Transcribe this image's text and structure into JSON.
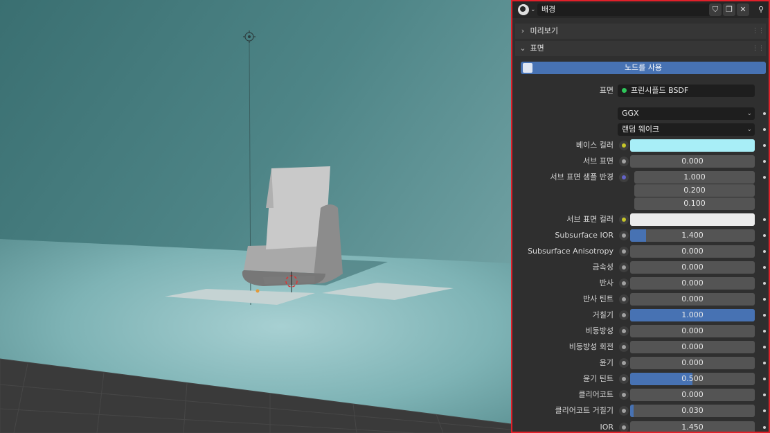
{
  "panel": {
    "world_name": "배경",
    "header_buttons": [
      "shield-icon",
      "copy-icon",
      "close-icon"
    ],
    "sections": {
      "preview": "미리보기",
      "surface": "표면"
    },
    "use_nodes_label": "노드를 사용",
    "surface_label": "표면",
    "surface_value": "프린시플드 BSDF",
    "distribution": "GGX",
    "subsurface_method": "랜덤 웨이크",
    "props": [
      {
        "label": "베이스 컬러",
        "type": "color",
        "color": "#a8eef7",
        "socket": "yellow"
      },
      {
        "label": "서브 표면",
        "value": "0.000",
        "fill": 0
      },
      {
        "label": "서브 표면 샘플 반경",
        "value": "1.000",
        "socket": "purple",
        "vector": [
          "1.000",
          "0.200",
          "0.100"
        ]
      },
      {
        "label": "서브 표면 컬러",
        "type": "color",
        "color": "#ececec",
        "socket": "yellow"
      },
      {
        "label": "Subsurface IOR",
        "value": "1.400",
        "fill": 0.13
      },
      {
        "label": "Subsurface Anisotropy",
        "value": "0.000",
        "fill": 0
      },
      {
        "label": "금속성",
        "value": "0.000",
        "fill": 0
      },
      {
        "label": "반사",
        "value": "0.000",
        "fill": 0
      },
      {
        "label": "반사 틴트",
        "value": "0.000",
        "fill": 0
      },
      {
        "label": "거칠기",
        "value": "1.000",
        "fill": 1.0
      },
      {
        "label": "비등방성",
        "value": "0.000",
        "fill": 0
      },
      {
        "label": "비등방성 회전",
        "value": "0.000",
        "fill": 0
      },
      {
        "label": "윤기",
        "value": "0.000",
        "fill": 0
      },
      {
        "label": "윤기 틴트",
        "value": "0.500",
        "fill": 0.5
      },
      {
        "label": "클리어코트",
        "value": "0.000",
        "fill": 0
      },
      {
        "label": "클리어코트 거칠기",
        "value": "0.030",
        "fill": 0.03
      },
      {
        "label": "IOR",
        "value": "1.450",
        "fill": 0
      }
    ]
  },
  "colors": {
    "accent": "#4772b3",
    "highlight_border": "#e2202a",
    "background": "#5f9a9c"
  }
}
